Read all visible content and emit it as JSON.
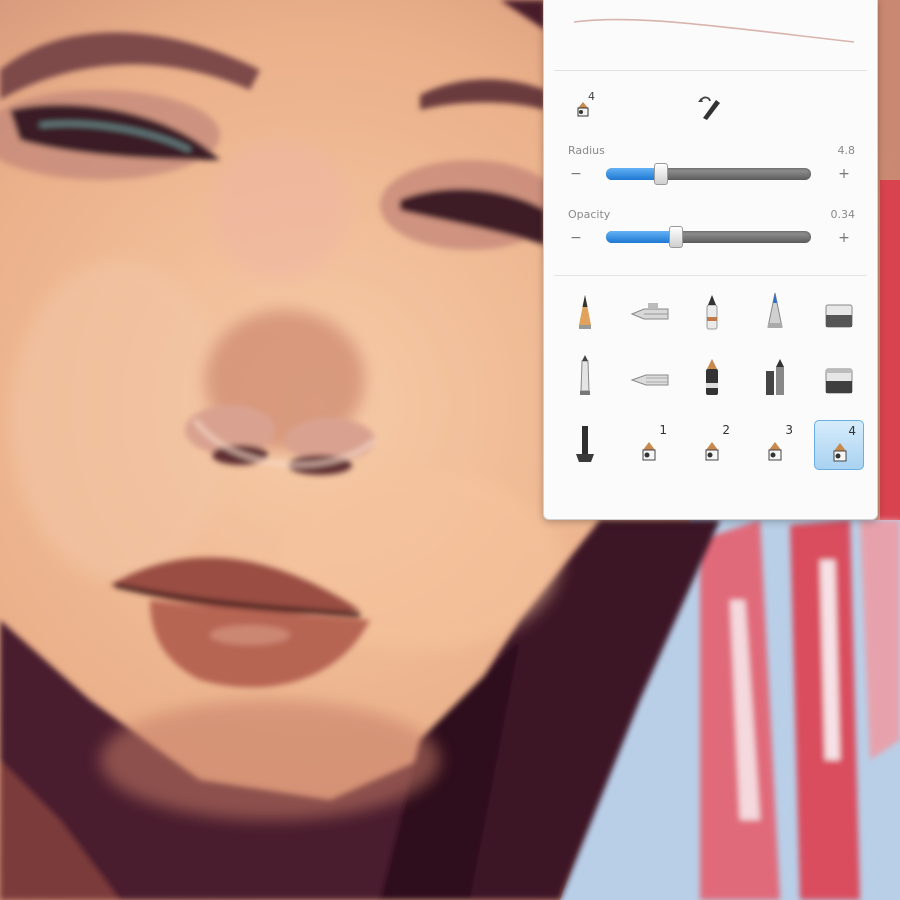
{
  "canvas": {
    "subject": "painted portrait",
    "palette": {
      "skin": "#f0b990",
      "hair": "#3a1424",
      "accent_red": "#d8434f",
      "sky_blue": "#b8cfe6"
    }
  },
  "brush_panel": {
    "current_brush_index": "4",
    "brush_icon": "paint-brush-icon",
    "swap_icon": "pen-tool-icon",
    "radius": {
      "label": "Radius",
      "value": "4.8",
      "fraction": 0.27
    },
    "opacity": {
      "label": "Opacity",
      "value": "0.34",
      "fraction": 0.34
    },
    "minus_symbol": "−",
    "plus_symbol": "+",
    "tools": [
      {
        "name": "pencil",
        "icon": "pencil-icon",
        "number": ""
      },
      {
        "name": "airbrush",
        "icon": "airbrush-icon",
        "number": ""
      },
      {
        "name": "marker",
        "icon": "marker-icon",
        "number": ""
      },
      {
        "name": "ballpoint-pen",
        "icon": "ballpoint-pen-icon",
        "number": ""
      },
      {
        "name": "eraser",
        "icon": "eraser-icon",
        "number": ""
      },
      {
        "name": "paintbrush",
        "icon": "paintbrush-icon",
        "number": ""
      },
      {
        "name": "smear",
        "icon": "smear-icon",
        "number": ""
      },
      {
        "name": "chisel-marker",
        "icon": "chisel-marker-icon",
        "number": ""
      },
      {
        "name": "brush-pens",
        "icon": "brush-pens-icon",
        "number": ""
      },
      {
        "name": "fill-bucket",
        "icon": "fill-bucket-icon",
        "number": ""
      },
      {
        "name": "blender",
        "icon": "blender-icon",
        "number": ""
      },
      {
        "name": "custom-brush-1",
        "icon": "custom-brush-icon",
        "number": "1"
      },
      {
        "name": "custom-brush-2",
        "icon": "custom-brush-icon",
        "number": "2"
      },
      {
        "name": "custom-brush-3",
        "icon": "custom-brush-icon",
        "number": "3"
      },
      {
        "name": "custom-brush-4",
        "icon": "custom-brush-icon",
        "number": "4",
        "selected": true
      }
    ]
  }
}
